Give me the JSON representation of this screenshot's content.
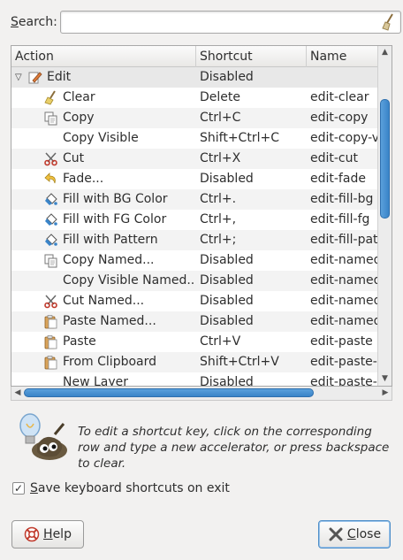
{
  "search": {
    "label_prefix": "S",
    "label_rest": "earch:",
    "value": "",
    "placeholder": ""
  },
  "columns": {
    "action": "Action",
    "shortcut": "Shortcut",
    "name": "Name"
  },
  "rows": [
    {
      "label": "Edit",
      "shortcut": "Disabled",
      "name": "",
      "icon": "edit-pencil-icon",
      "group": true
    },
    {
      "label": "Clear",
      "shortcut": "Delete",
      "name": "edit-clear",
      "icon": "broom-icon"
    },
    {
      "label": "Copy",
      "shortcut": "Ctrl+C",
      "name": "edit-copy",
      "icon": "copy-icon"
    },
    {
      "label": "Copy Visible",
      "shortcut": "Shift+Ctrl+C",
      "name": "edit-copy-v",
      "icon": ""
    },
    {
      "label": "Cut",
      "shortcut": "Ctrl+X",
      "name": "edit-cut",
      "icon": "scissors-icon"
    },
    {
      "label": "Fade...",
      "shortcut": "Disabled",
      "name": "edit-fade",
      "icon": "undo-arrow-icon"
    },
    {
      "label": "Fill with BG Color",
      "shortcut": "Ctrl+.",
      "name": "edit-fill-bg",
      "icon": "bucket-fill-icon"
    },
    {
      "label": "Fill with FG Color",
      "shortcut": "Ctrl+,",
      "name": "edit-fill-fg",
      "icon": "bucket-fill-icon"
    },
    {
      "label": "Fill with Pattern",
      "shortcut": "Ctrl+;",
      "name": "edit-fill-pat",
      "icon": "bucket-fill-icon"
    },
    {
      "label": "Copy Named...",
      "shortcut": "Disabled",
      "name": "edit-named",
      "icon": "copy-icon"
    },
    {
      "label": "Copy Visible Named...",
      "shortcut": "Disabled",
      "name": "edit-named",
      "icon": ""
    },
    {
      "label": "Cut Named...",
      "shortcut": "Disabled",
      "name": "edit-named",
      "icon": "scissors-icon"
    },
    {
      "label": "Paste Named...",
      "shortcut": "Disabled",
      "name": "edit-named",
      "icon": "paste-icon"
    },
    {
      "label": "Paste",
      "shortcut": "Ctrl+V",
      "name": "edit-paste",
      "icon": "paste-icon"
    },
    {
      "label": "From Clipboard",
      "shortcut": "Shift+Ctrl+V",
      "name": "edit-paste-a",
      "icon": "paste-icon"
    },
    {
      "label": "New Layer",
      "shortcut": "Disabled",
      "name": "edit-paste-a",
      "icon": ""
    }
  ],
  "hint": {
    "text": "To edit a shortcut key, click on the corresponding row and type a new accelerator, or press backspace to clear.",
    "icon": "gimp-wilber-lightbulb-icon"
  },
  "save_option": {
    "label_prefix": "S",
    "label_rest": "ave keyboard shortcuts on exit",
    "checked": true
  },
  "buttons": {
    "help": {
      "prefix": "H",
      "rest": "elp",
      "icon": "help-lifebuoy-icon"
    },
    "close": {
      "prefix": "C",
      "rest": "lose",
      "icon": "close-x-icon"
    }
  },
  "colors": {
    "selection_accent": "#3a84c8",
    "window_bg": "#f2f1f0"
  }
}
